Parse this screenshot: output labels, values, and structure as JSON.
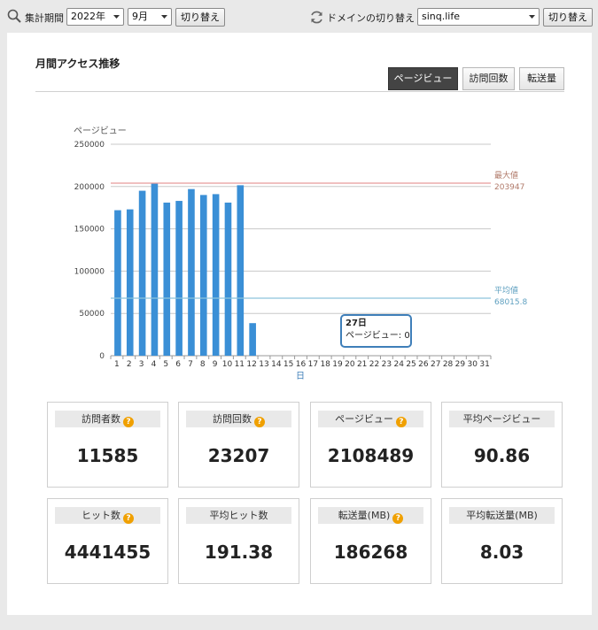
{
  "toolbar": {
    "period_label": "集計期間",
    "year": "2022年",
    "month": "9月",
    "switch_label": "切り替え",
    "domain_switch_label": "ドメインの切り替え",
    "domain": "sinq.life",
    "domain_switch_button": "切り替え"
  },
  "panel": {
    "title": "月間アクセス推移",
    "tabs": [
      {
        "label": "ページビュー",
        "active": true
      },
      {
        "label": "訪問回数",
        "active": false
      },
      {
        "label": "転送量",
        "active": false
      }
    ]
  },
  "chart_data": {
    "type": "bar",
    "ylabel": "ページビュー",
    "xlabel": "日",
    "ylim": [
      0,
      250000
    ],
    "yticks": [
      "250000",
      "200000",
      "150000",
      "100000",
      "50000",
      "0"
    ],
    "categories": [
      "1",
      "2",
      "3",
      "4",
      "5",
      "6",
      "7",
      "8",
      "9",
      "10",
      "11",
      "12",
      "13",
      "14",
      "15",
      "16",
      "17",
      "18",
      "19",
      "20",
      "21",
      "22",
      "23",
      "24",
      "25",
      "26",
      "27",
      "28",
      "29",
      "30",
      "31"
    ],
    "series": [
      {
        "name": "ページビュー",
        "color": "#3a8fd6",
        "values": [
          172000,
          173000,
          195000,
          203947,
          181000,
          183000,
          197000,
          190000,
          191000,
          181000,
          201500,
          38500,
          0,
          0,
          0,
          0,
          0,
          0,
          0,
          0,
          0,
          0,
          0,
          0,
          0,
          0,
          0,
          0,
          0,
          0,
          0
        ]
      }
    ],
    "max_line": {
      "label": "最大値",
      "value": 203947,
      "value_text": "203947",
      "color": "#e89a9a"
    },
    "avg_line": {
      "label": "平均値",
      "value": 68015.8,
      "value_text": "68015.8",
      "color": "#8cc3dc"
    },
    "tooltip": {
      "title": "27日",
      "text": "ページビュー: 0"
    },
    "grid": true
  },
  "stats": [
    {
      "label": "訪問者数",
      "value": "11585",
      "help": true
    },
    {
      "label": "訪問回数",
      "value": "23207",
      "help": true
    },
    {
      "label": "ページビュー",
      "value": "2108489",
      "help": true
    },
    {
      "label": "平均ページビュー",
      "value": "90.86",
      "help": false
    },
    {
      "label": "ヒット数",
      "value": "4441455",
      "help": true
    },
    {
      "label": "平均ヒット数",
      "value": "191.38",
      "help": false
    },
    {
      "label": "転送量(MB)",
      "value": "186268",
      "help": true
    },
    {
      "label": "平均転送量(MB)",
      "value": "8.03",
      "help": false
    }
  ],
  "icons": {
    "help": "?"
  }
}
